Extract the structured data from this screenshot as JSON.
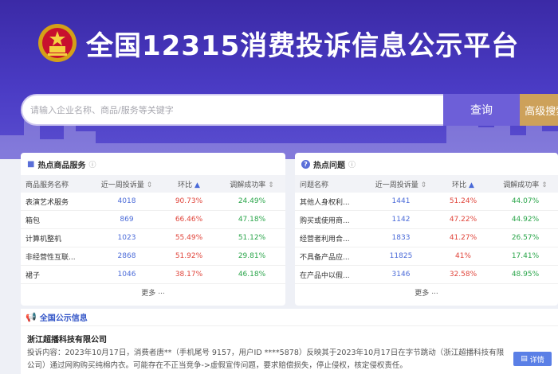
{
  "header": {
    "title": "全国12315消费投诉信息公示平台",
    "colors": {
      "hero": "#3b2aa6",
      "search_button": "#6d5fd8",
      "advanced_button": "#cda15a"
    }
  },
  "search": {
    "placeholder": "请输入企业名称、商品/服务等关键字",
    "button_label": "查询",
    "advanced_label": "高级搜索"
  },
  "hot_products": {
    "title": "热点商品服务",
    "columns": [
      "商品服务名称",
      "近一周投诉量",
      "环比",
      "调解成功率"
    ],
    "rows": [
      [
        "表演艺术服务",
        "4018",
        "90.73%",
        "24.49%"
      ],
      [
        "箱包",
        "869",
        "66.46%",
        "47.18%"
      ],
      [
        "计算机整机",
        "1023",
        "55.49%",
        "51.12%"
      ],
      [
        "非经营性互联...",
        "2868",
        "51.92%",
        "29.81%"
      ],
      [
        "裙子",
        "1046",
        "38.17%",
        "46.18%"
      ]
    ],
    "more_label": "更多"
  },
  "hot_issues": {
    "title": "热点问题",
    "columns": [
      "问题名称",
      "近一周投诉量",
      "环比",
      "调解成功率"
    ],
    "rows": [
      [
        "其他人身权利...",
        "1441",
        "51.24%",
        "44.07%"
      ],
      [
        "购买或使用商...",
        "1142",
        "47.22%",
        "44.92%"
      ],
      [
        "经营者利用合...",
        "1833",
        "41.27%",
        "26.57%"
      ],
      [
        "不具备产品应...",
        "11825",
        "41%",
        "17.41%"
      ],
      [
        "在产品中以假...",
        "3146",
        "32.58%",
        "48.95%"
      ]
    ],
    "more_label": "更多"
  },
  "notice": {
    "title": "全国公示信息",
    "company": "浙江超播科技有限公司",
    "body": "投诉内容：2023年10月17日，消费者唐**（手机尾号 9157，用户ID ****5878）反映其于2023年10月17日在字节跳动（浙江超播科技有限公司）通过网购购买纯棉内衣。可能存在不正当竞争->虚假宣传问题，要求赔偿损失，停止侵权，核定侵权责任。",
    "detail_label": "详情"
  }
}
